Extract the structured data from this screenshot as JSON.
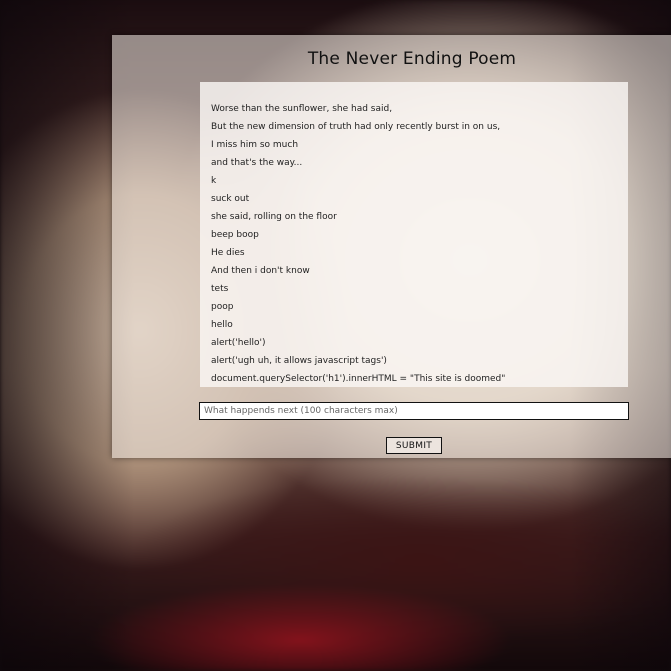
{
  "page": {
    "title": "The Never Ending Poem"
  },
  "poem": {
    "lines": [
      "Worse than the sunflower, she had said,",
      "But the new dimension of truth had only recently burst in on us,",
      "I miss him so much",
      "and that's the way...",
      "k",
      "suck out",
      "she said, rolling on the floor",
      "beep boop",
      "He dies",
      "And then i don't know",
      "tets",
      "poop",
      "hello",
      "alert('hello')",
      "alert('ugh uh, it allows javascript tags')",
      "document.querySelector('h1').innerHTML = \"This site is doomed\""
    ]
  },
  "form": {
    "input_placeholder": "What happends next (100 characters max)",
    "input_value": "",
    "submit_label": "SUBMIT"
  }
}
